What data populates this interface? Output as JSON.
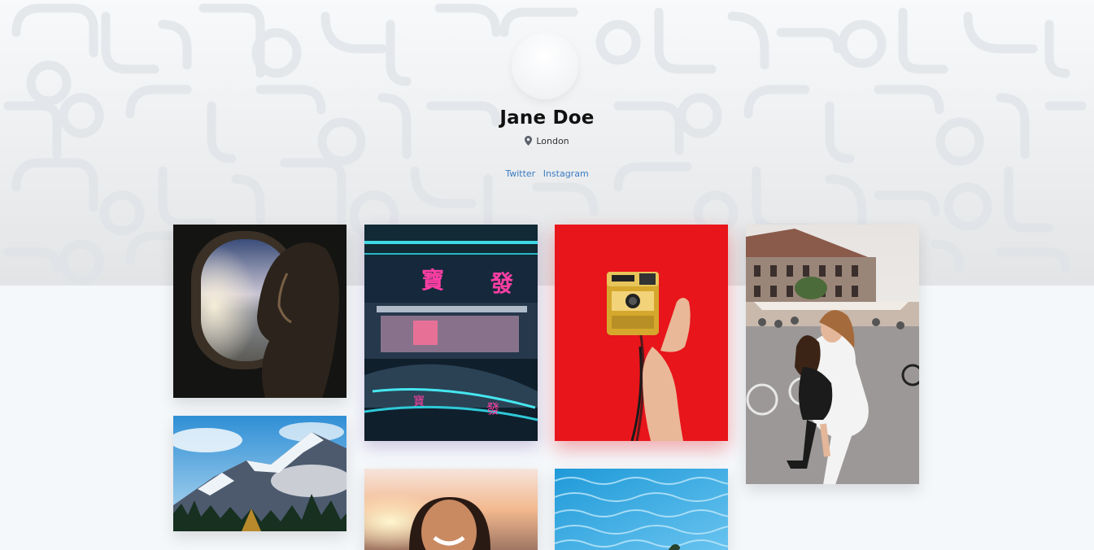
{
  "profile": {
    "name": "Jane Doe",
    "location": "London",
    "location_icon": "map-pin-icon"
  },
  "links": [
    {
      "label": "Twitter"
    },
    {
      "label": "Instagram"
    }
  ],
  "gallery": {
    "photos": [
      {
        "name": "photo-airplane-window",
        "subject": "person looking out airplane window"
      },
      {
        "name": "photo-snowy-mountains",
        "subject": "snowy mountain range with pine trees"
      },
      {
        "name": "photo-neon-street",
        "subject": "neon lit street at night"
      },
      {
        "name": "photo-smiling-woman",
        "subject": "smiling woman at sunset"
      },
      {
        "name": "photo-polaroid-camera",
        "subject": "hand holding yellow camera on red background"
      },
      {
        "name": "photo-pool-water",
        "subject": "blue pool water"
      },
      {
        "name": "photo-two-friends",
        "subject": "two friends piggyback in a street"
      }
    ]
  },
  "colors": {
    "link": "#3b7cc2",
    "background": "#f5f8fb",
    "red_backdrop": "#e8151b"
  }
}
